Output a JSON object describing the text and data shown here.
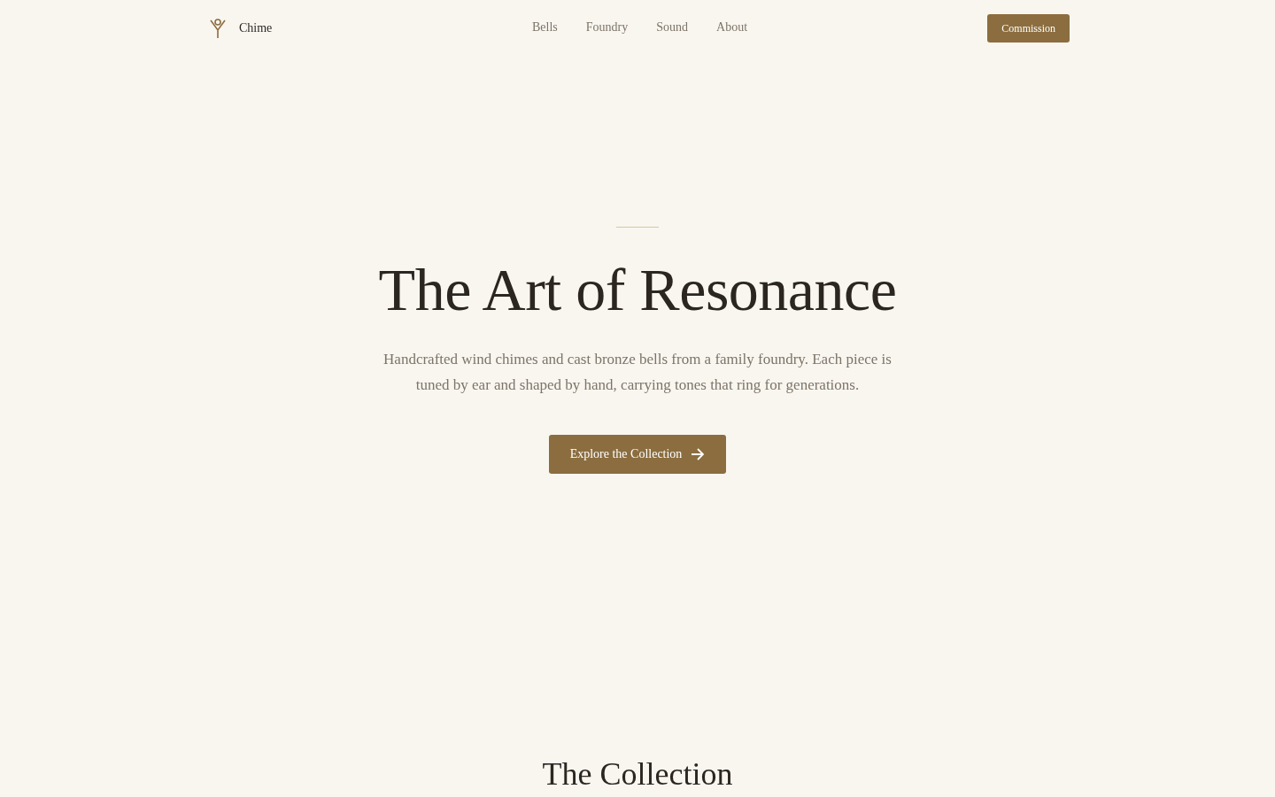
{
  "brand": {
    "name": "Chime"
  },
  "nav": [
    {
      "label": "Bells"
    },
    {
      "label": "Foundry"
    },
    {
      "label": "Sound"
    },
    {
      "label": "About"
    }
  ],
  "cta": "Commission",
  "hero": {
    "title": "The Art of Resonance",
    "text": "Handcrafted wind chimes and cast bronze bells from a family foundry. Each piece is tuned by ear and shaped by hand, carrying tones that ring for generations.",
    "button": "Explore the Collection"
  },
  "section": {
    "title": "The Collection"
  }
}
